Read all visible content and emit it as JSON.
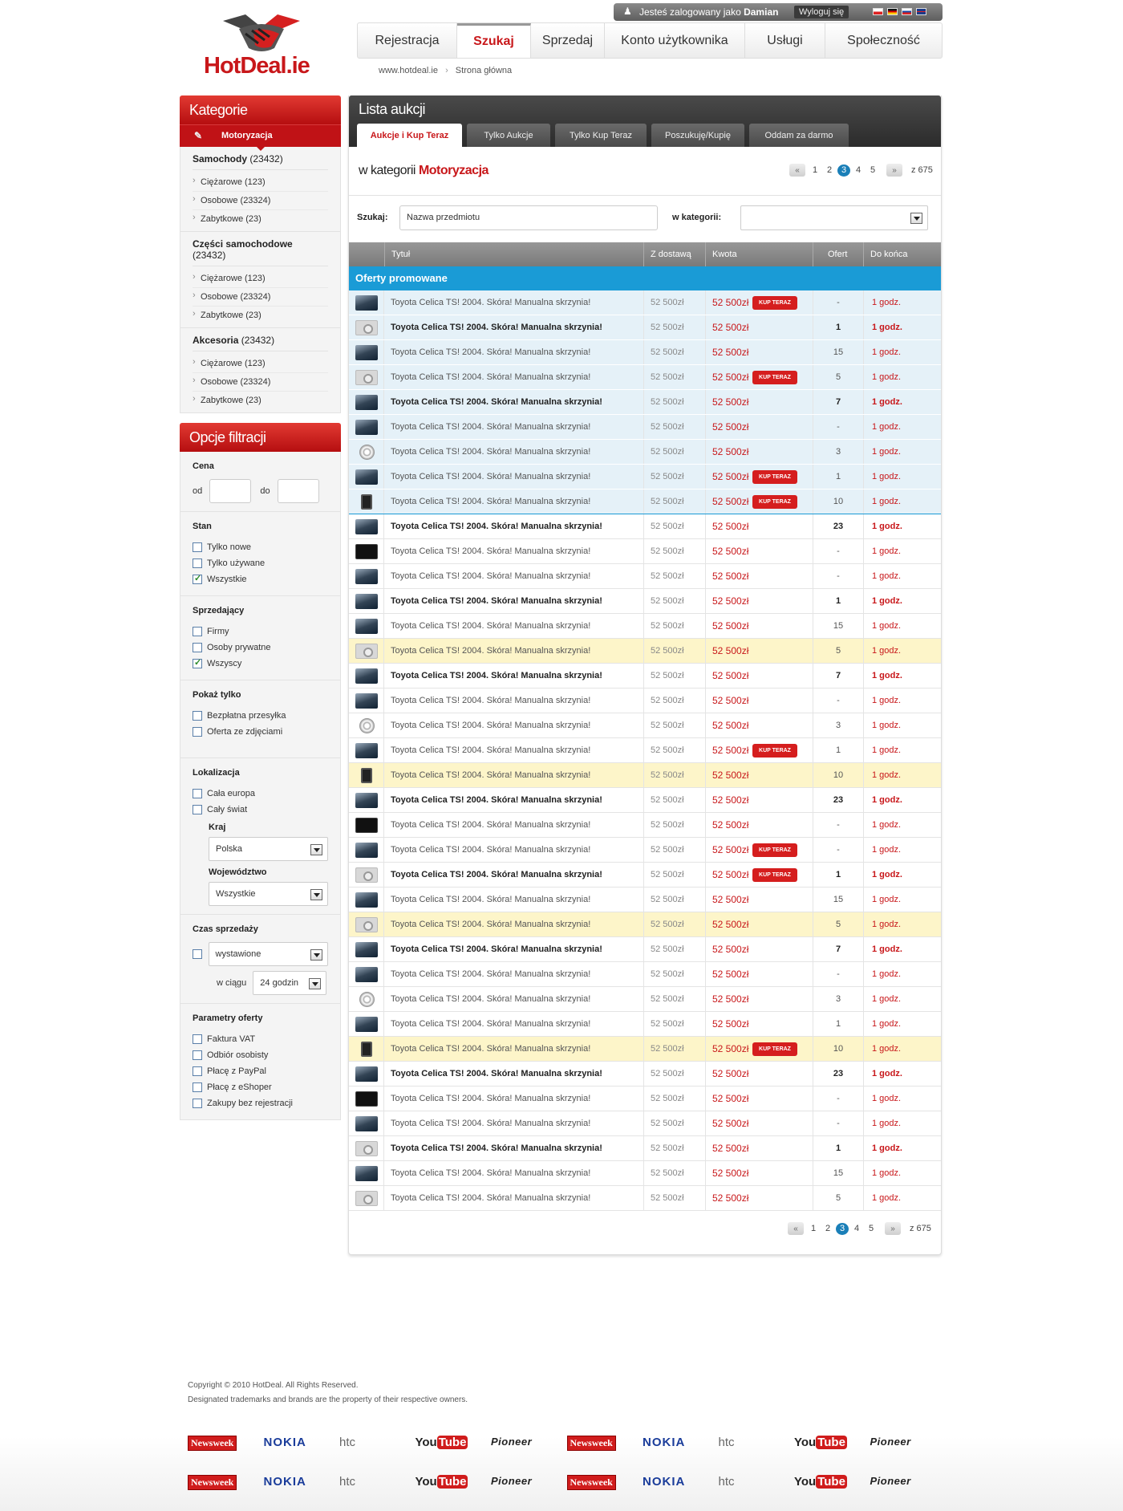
{
  "header": {
    "logo_text": "HotDeal.ie",
    "user_prefix": "Jesteś zalogowany jako",
    "user_name": "Damian",
    "logout_label": "Wyloguj się",
    "flags": [
      "pl-flag-icon",
      "de-flag-icon",
      "sk-flag-icon",
      "uk-flag-icon"
    ],
    "nav": [
      {
        "label": "Rejestracja",
        "active": false
      },
      {
        "label": "Szukaj",
        "active": true
      },
      {
        "label": "Sprzedaj",
        "active": false
      },
      {
        "label": "Konto użytkownika",
        "active": false
      },
      {
        "label": "Usługi",
        "active": false
      },
      {
        "label": "Społeczność",
        "active": false
      }
    ],
    "breadcrumb": [
      "www.hotdeal.ie",
      "Strona główna"
    ]
  },
  "sidebar": {
    "categories_title": "Kategorie",
    "current_category": "Motoryzacja",
    "groups": [
      {
        "name": "Samochody",
        "count": "(23432)",
        "items": [
          "Ciężarowe (123)",
          "Osobowe (23324)",
          "Zabytkowe (23)"
        ]
      },
      {
        "name": "Części samochodowe",
        "count": "(23432)",
        "items": [
          "Ciężarowe (123)",
          "Osobowe (23324)",
          "Zabytkowe (23)"
        ]
      },
      {
        "name": "Akcesoria",
        "count": "(23432)",
        "items": [
          "Ciężarowe (123)",
          "Osobowe (23324)",
          "Zabytkowe (23)"
        ]
      }
    ],
    "filters_title": "Opcje filtracji",
    "price": {
      "label": "Cena",
      "from": "od",
      "to": "do"
    },
    "stan": {
      "label": "Stan",
      "options": [
        {
          "label": "Tylko nowe",
          "checked": false
        },
        {
          "label": "Tylko używane",
          "checked": false
        },
        {
          "label": "Wszystkie",
          "checked": true
        }
      ]
    },
    "seller": {
      "label": "Sprzedający",
      "options": [
        {
          "label": "Firmy",
          "checked": false
        },
        {
          "label": "Osoby prywatne",
          "checked": false
        },
        {
          "label": "Wszyscy",
          "checked": true
        }
      ]
    },
    "show_only": {
      "label": "Pokaż tylko",
      "options": [
        {
          "label": "Bezpłatna przesyłka",
          "checked": false
        },
        {
          "label": "Oferta ze zdjęciami",
          "checked": false
        }
      ]
    },
    "location": {
      "label": "Lokalizacja",
      "options": [
        {
          "label": "Cała europa",
          "checked": false
        },
        {
          "label": "Cały świat",
          "checked": false
        }
      ],
      "country_label": "Kraj",
      "country_value": "Polska",
      "region_label": "Województwo",
      "region_value": "Wszystkie"
    },
    "sale_time": {
      "label": "Czas sprzedaży",
      "select_value": "wystawione",
      "within_label": "w ciągu",
      "within_value": "24 godzin"
    },
    "params": {
      "label": "Parametry oferty",
      "options": [
        {
          "label": "Faktura VAT",
          "checked": false
        },
        {
          "label": "Odbiór osobisty",
          "checked": false
        },
        {
          "label": "Płacę z PayPal",
          "checked": false
        },
        {
          "label": "Płacę z eShoper",
          "checked": false
        },
        {
          "label": "Zakupy bez rejestracji",
          "checked": false
        }
      ]
    }
  },
  "main": {
    "title": "Lista aukcji",
    "tabs": [
      {
        "label": "Aukcje i Kup Teraz",
        "active": true
      },
      {
        "label": "Tylko Aukcje",
        "active": false
      },
      {
        "label": "Tylko Kup Teraz",
        "active": false
      },
      {
        "label": "Poszukuję/Kupię",
        "active": false
      },
      {
        "label": "Oddam za darmo",
        "active": false
      }
    ],
    "category_prefix": "w kategorii",
    "category_name": "Motoryzacja",
    "pager": {
      "pages": [
        "1",
        "2",
        "3",
        "4",
        "5"
      ],
      "current": "3",
      "total": "z 675",
      "prev": "«",
      "next": "»"
    },
    "search_label": "Szukaj:",
    "search_value": "Nazwa przedmiotu",
    "category_label": "w kategorii:",
    "columns": [
      "Tytuł",
      "Z dostawą",
      "Kwota",
      "Ofert",
      "Do końca"
    ],
    "promo_label": "Oferty promowane",
    "buy_now_label": "KUP TERAZ",
    "rows": [
      {
        "img": "car",
        "title": "Toyota Celica TS! 2004. Skóra! Manualna skrzynia!",
        "ship": "52 500zł",
        "price": "52 500zł",
        "bids": "-",
        "left": "1 godz.",
        "kup": true,
        "bold": false,
        "promo": true,
        "hl": false
      },
      {
        "img": "camera",
        "title": "Toyota Celica TS! 2004. Skóra! Manualna skrzynia!",
        "ship": "52 500zł",
        "price": "52 500zł",
        "bids": "1",
        "left": "1 godz.",
        "kup": false,
        "bold": true,
        "promo": true,
        "hl": false
      },
      {
        "img": "car",
        "title": "Toyota Celica TS! 2004. Skóra! Manualna skrzynia!",
        "ship": "52 500zł",
        "price": "52 500zł",
        "bids": "15",
        "left": "1 godz.",
        "kup": false,
        "bold": false,
        "promo": true,
        "hl": false
      },
      {
        "img": "camera",
        "title": "Toyota Celica TS! 2004. Skóra! Manualna skrzynia!",
        "ship": "52 500zł",
        "price": "52 500zł",
        "bids": "5",
        "left": "1 godz.",
        "kup": true,
        "bold": false,
        "promo": true,
        "hl": false
      },
      {
        "img": "car",
        "title": "Toyota Celica TS! 2004. Skóra! Manualna skrzynia!",
        "ship": "52 500zł",
        "price": "52 500zł",
        "bids": "7",
        "left": "1 godz.",
        "kup": false,
        "bold": true,
        "promo": true,
        "hl": false
      },
      {
        "img": "car",
        "title": "Toyota Celica TS! 2004. Skóra! Manualna skrzynia!",
        "ship": "52 500zł",
        "price": "52 500zł",
        "bids": "-",
        "left": "1 godz.",
        "kup": false,
        "bold": false,
        "promo": true,
        "hl": false
      },
      {
        "img": "wheel",
        "title": "Toyota Celica TS! 2004. Skóra! Manualna skrzynia!",
        "ship": "52 500zł",
        "price": "52 500zł",
        "bids": "3",
        "left": "1 godz.",
        "kup": false,
        "bold": false,
        "promo": true,
        "hl": false
      },
      {
        "img": "car",
        "title": "Toyota Celica TS! 2004. Skóra! Manualna skrzynia!",
        "ship": "52 500zł",
        "price": "52 500zł",
        "bids": "1",
        "left": "1 godz.",
        "kup": true,
        "bold": false,
        "promo": true,
        "hl": false
      },
      {
        "img": "tablet",
        "title": "Toyota Celica TS! 2004. Skóra! Manualna skrzynia!",
        "ship": "52 500zł",
        "price": "52 500zł",
        "bids": "10",
        "left": "1 godz.",
        "kup": true,
        "bold": false,
        "promo": true,
        "hl": false
      },
      {
        "img": "car",
        "title": "Toyota Celica TS! 2004. Skóra! Manualna skrzynia!",
        "ship": "52 500zł",
        "price": "52 500zł",
        "bids": "23",
        "left": "1 godz.",
        "kup": false,
        "bold": true,
        "promo": false,
        "hl": false
      },
      {
        "img": "tv",
        "title": "Toyota Celica TS! 2004. Skóra! Manualna skrzynia!",
        "ship": "52 500zł",
        "price": "52 500zł",
        "bids": "-",
        "left": "1 godz.",
        "kup": false,
        "bold": false,
        "promo": false,
        "hl": false
      },
      {
        "img": "car",
        "title": "Toyota Celica TS! 2004. Skóra! Manualna skrzynia!",
        "ship": "52 500zł",
        "price": "52 500zł",
        "bids": "-",
        "left": "1 godz.",
        "kup": false,
        "bold": false,
        "promo": false,
        "hl": false
      },
      {
        "img": "car",
        "title": "Toyota Celica TS! 2004. Skóra! Manualna skrzynia!",
        "ship": "52 500zł",
        "price": "52 500zł",
        "bids": "1",
        "left": "1 godz.",
        "kup": false,
        "bold": true,
        "promo": false,
        "hl": false
      },
      {
        "img": "car",
        "title": "Toyota Celica TS! 2004. Skóra! Manualna skrzynia!",
        "ship": "52 500zł",
        "price": "52 500zł",
        "bids": "15",
        "left": "1 godz.",
        "kup": false,
        "bold": false,
        "promo": false,
        "hl": false
      },
      {
        "img": "camera",
        "title": "Toyota Celica TS! 2004. Skóra! Manualna skrzynia!",
        "ship": "52 500zł",
        "price": "52 500zł",
        "bids": "5",
        "left": "1 godz.",
        "kup": false,
        "bold": false,
        "promo": false,
        "hl": true
      },
      {
        "img": "car",
        "title": "Toyota Celica TS! 2004. Skóra! Manualna skrzynia!",
        "ship": "52 500zł",
        "price": "52 500zł",
        "bids": "7",
        "left": "1 godz.",
        "kup": false,
        "bold": true,
        "promo": false,
        "hl": false
      },
      {
        "img": "car",
        "title": "Toyota Celica TS! 2004. Skóra! Manualna skrzynia!",
        "ship": "52 500zł",
        "price": "52 500zł",
        "bids": "-",
        "left": "1 godz.",
        "kup": false,
        "bold": false,
        "promo": false,
        "hl": false
      },
      {
        "img": "wheel",
        "title": "Toyota Celica TS! 2004. Skóra! Manualna skrzynia!",
        "ship": "52 500zł",
        "price": "52 500zł",
        "bids": "3",
        "left": "1 godz.",
        "kup": false,
        "bold": false,
        "promo": false,
        "hl": false
      },
      {
        "img": "car",
        "title": "Toyota Celica TS! 2004. Skóra! Manualna skrzynia!",
        "ship": "52 500zł",
        "price": "52 500zł",
        "bids": "1",
        "left": "1 godz.",
        "kup": true,
        "bold": false,
        "promo": false,
        "hl": false
      },
      {
        "img": "tablet",
        "title": "Toyota Celica TS! 2004. Skóra! Manualna skrzynia!",
        "ship": "52 500zł",
        "price": "52 500zł",
        "bids": "10",
        "left": "1 godz.",
        "kup": false,
        "bold": false,
        "promo": false,
        "hl": true
      },
      {
        "img": "car",
        "title": "Toyota Celica TS! 2004. Skóra! Manualna skrzynia!",
        "ship": "52 500zł",
        "price": "52 500zł",
        "bids": "23",
        "left": "1 godz.",
        "kup": false,
        "bold": true,
        "promo": false,
        "hl": false
      },
      {
        "img": "tv",
        "title": "Toyota Celica TS! 2004. Skóra! Manualna skrzynia!",
        "ship": "52 500zł",
        "price": "52 500zł",
        "bids": "-",
        "left": "1 godz.",
        "kup": false,
        "bold": false,
        "promo": false,
        "hl": false
      },
      {
        "img": "car",
        "title": "Toyota Celica TS! 2004. Skóra! Manualna skrzynia!",
        "ship": "52 500zł",
        "price": "52 500zł",
        "bids": "-",
        "left": "1 godz.",
        "kup": true,
        "bold": false,
        "promo": false,
        "hl": false
      },
      {
        "img": "camera",
        "title": "Toyota Celica TS! 2004. Skóra! Manualna skrzynia!",
        "ship": "52 500zł",
        "price": "52 500zł",
        "bids": "1",
        "left": "1 godz.",
        "kup": true,
        "bold": true,
        "promo": false,
        "hl": false
      },
      {
        "img": "car",
        "title": "Toyota Celica TS! 2004. Skóra! Manualna skrzynia!",
        "ship": "52 500zł",
        "price": "52 500zł",
        "bids": "15",
        "left": "1 godz.",
        "kup": false,
        "bold": false,
        "promo": false,
        "hl": false
      },
      {
        "img": "camera",
        "title": "Toyota Celica TS! 2004. Skóra! Manualna skrzynia!",
        "ship": "52 500zł",
        "price": "52 500zł",
        "bids": "5",
        "left": "1 godz.",
        "kup": false,
        "bold": false,
        "promo": false,
        "hl": true
      },
      {
        "img": "car",
        "title": "Toyota Celica TS! 2004. Skóra! Manualna skrzynia!",
        "ship": "52 500zł",
        "price": "52 500zł",
        "bids": "7",
        "left": "1 godz.",
        "kup": false,
        "bold": true,
        "promo": false,
        "hl": false
      },
      {
        "img": "car",
        "title": "Toyota Celica TS! 2004. Skóra! Manualna skrzynia!",
        "ship": "52 500zł",
        "price": "52 500zł",
        "bids": "-",
        "left": "1 godz.",
        "kup": false,
        "bold": false,
        "promo": false,
        "hl": false
      },
      {
        "img": "wheel",
        "title": "Toyota Celica TS! 2004. Skóra! Manualna skrzynia!",
        "ship": "52 500zł",
        "price": "52 500zł",
        "bids": "3",
        "left": "1 godz.",
        "kup": false,
        "bold": false,
        "promo": false,
        "hl": false
      },
      {
        "img": "car",
        "title": "Toyota Celica TS! 2004. Skóra! Manualna skrzynia!",
        "ship": "52 500zł",
        "price": "52 500zł",
        "bids": "1",
        "left": "1 godz.",
        "kup": false,
        "bold": false,
        "promo": false,
        "hl": false
      },
      {
        "img": "tablet",
        "title": "Toyota Celica TS! 2004. Skóra! Manualna skrzynia!",
        "ship": "52 500zł",
        "price": "52 500zł",
        "bids": "10",
        "left": "1 godz.",
        "kup": true,
        "bold": false,
        "promo": false,
        "hl": true
      },
      {
        "img": "car",
        "title": "Toyota Celica TS! 2004. Skóra! Manualna skrzynia!",
        "ship": "52 500zł",
        "price": "52 500zł",
        "bids": "23",
        "left": "1 godz.",
        "kup": false,
        "bold": true,
        "promo": false,
        "hl": false
      },
      {
        "img": "tv",
        "title": "Toyota Celica TS! 2004. Skóra! Manualna skrzynia!",
        "ship": "52 500zł",
        "price": "52 500zł",
        "bids": "-",
        "left": "1 godz.",
        "kup": false,
        "bold": false,
        "promo": false,
        "hl": false
      },
      {
        "img": "car",
        "title": "Toyota Celica TS! 2004. Skóra! Manualna skrzynia!",
        "ship": "52 500zł",
        "price": "52 500zł",
        "bids": "-",
        "left": "1 godz.",
        "kup": false,
        "bold": false,
        "promo": false,
        "hl": false
      },
      {
        "img": "camera",
        "title": "Toyota Celica TS! 2004. Skóra! Manualna skrzynia!",
        "ship": "52 500zł",
        "price": "52 500zł",
        "bids": "1",
        "left": "1 godz.",
        "kup": false,
        "bold": true,
        "promo": false,
        "hl": false
      },
      {
        "img": "car",
        "title": "Toyota Celica TS! 2004. Skóra! Manualna skrzynia!",
        "ship": "52 500zł",
        "price": "52 500zł",
        "bids": "15",
        "left": "1 godz.",
        "kup": false,
        "bold": false,
        "promo": false,
        "hl": false
      },
      {
        "img": "camera",
        "title": "Toyota Celica TS! 2004. Skóra! Manualna skrzynia!",
        "ship": "52 500zł",
        "price": "52 500zł",
        "bids": "5",
        "left": "1 godz.",
        "kup": false,
        "bold": false,
        "promo": false,
        "hl": false
      }
    ]
  },
  "footer": {
    "copyright": "Copyright © 2010 HotDeal. All Rights Reserved.",
    "trademarks": "Designated trademarks and brands are the property of their respective owners.",
    "brands": [
      "Newsweek",
      "NOKIA",
      "htc",
      "YouTube",
      "Pioneer",
      "Newsweek",
      "NOKIA",
      "htc",
      "YouTube",
      "Pioneer"
    ]
  }
}
